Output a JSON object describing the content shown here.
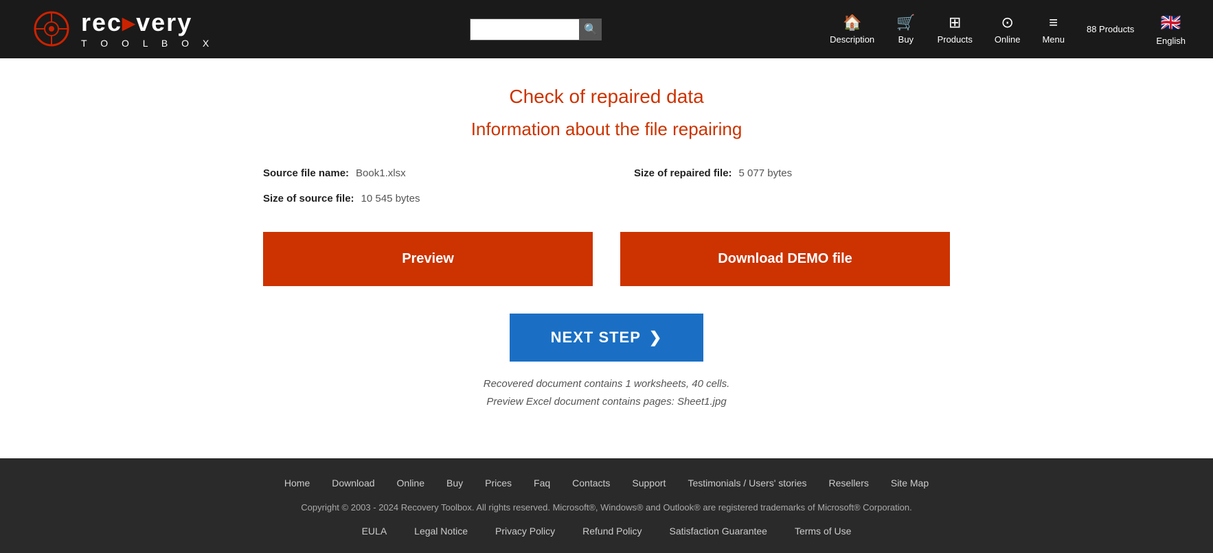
{
  "header": {
    "logo_main": "rec▸very",
    "logo_sub": "T O O L B O X",
    "search_placeholder": "",
    "products_count": "88 Products",
    "nav": [
      {
        "id": "description",
        "icon": "🏠",
        "label": "Description"
      },
      {
        "id": "buy",
        "icon": "🛒",
        "label": "Buy"
      },
      {
        "id": "products",
        "icon": "⊞",
        "label": "Products"
      },
      {
        "id": "online",
        "icon": "⊙",
        "label": "Online"
      },
      {
        "id": "menu",
        "icon": "≡",
        "label": "Menu"
      },
      {
        "id": "english",
        "flag": "🇬🇧",
        "label": "English"
      }
    ]
  },
  "main": {
    "title": "Check of repaired data",
    "subtitle": "Information about the file repairing",
    "source_file_label": "Source file name:",
    "source_file_value": "Book1.xlsx",
    "source_size_label": "Size of source file:",
    "source_size_value": "10 545 bytes",
    "repaired_size_label": "Size of repaired file:",
    "repaired_size_value": "5 077 bytes",
    "preview_btn": "Preview",
    "download_demo_btn": "Download DEMO file",
    "next_step_btn": "NEXT STEP",
    "recovered_line1": "Recovered document contains 1 worksheets, 40 cells.",
    "recovered_line2": "Preview Excel document contains pages: Sheet1.jpg"
  },
  "footer": {
    "nav_links": [
      "Home",
      "Download",
      "Online",
      "Buy",
      "Prices",
      "Faq",
      "Contacts",
      "Support",
      "Testimonials / Users' stories",
      "Resellers",
      "Site Map"
    ],
    "copyright": "Copyright © 2003 - 2024  Recovery Toolbox. All rights reserved. Microsoft®, Windows® and Outlook® are registered trademarks of Microsoft® Corporation.",
    "legal_links": [
      "EULA",
      "Legal Notice",
      "Privacy Policy",
      "Refund Policy",
      "Satisfaction Guarantee",
      "Terms of Use"
    ]
  }
}
